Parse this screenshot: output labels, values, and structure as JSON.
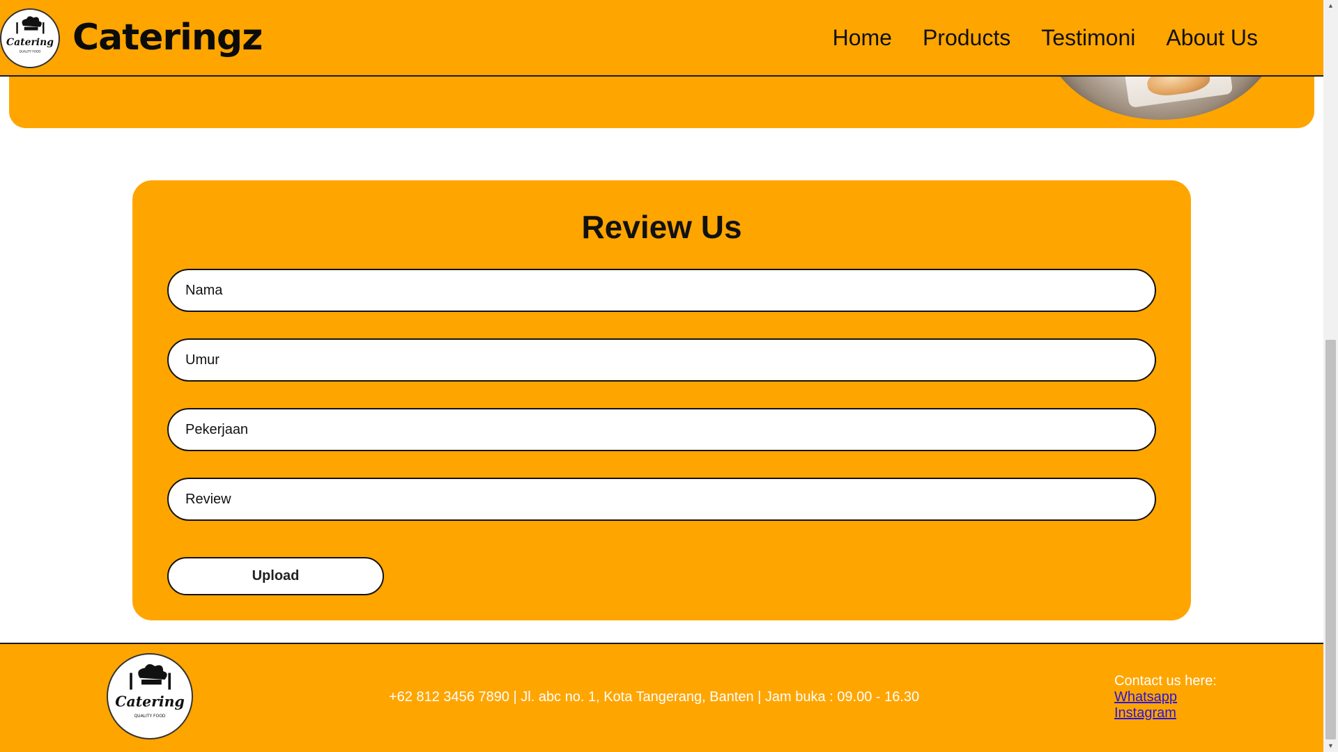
{
  "brand": {
    "name": "Cateringz",
    "logo_text": "Catering",
    "logo_subtext": "QUALITY FOOD",
    "logo_icon": "chef-hat-icon"
  },
  "nav": {
    "items": [
      {
        "label": "Home"
      },
      {
        "label": "Products"
      },
      {
        "label": "Testimoni"
      },
      {
        "label": "About Us"
      }
    ]
  },
  "review_form": {
    "title": "Review Us",
    "fields": [
      {
        "placeholder": "Nama"
      },
      {
        "placeholder": "Umur"
      },
      {
        "placeholder": "Pekerjaan"
      },
      {
        "placeholder": "Review"
      }
    ],
    "submit_label": "Upload"
  },
  "footer": {
    "info": "+62 812 3456 7890 | Jl. abc no. 1, Kota Tangerang, Banten | Jam buka : 09.00 - 16.30",
    "contact_heading": "Contact us here:",
    "links": [
      {
        "label": "Whatsapp"
      },
      {
        "label": "Instagram"
      }
    ]
  },
  "colors": {
    "primary": "#ffa500",
    "text": "#111111",
    "link": "#2a14d8",
    "footer_text": "#ffffff"
  }
}
